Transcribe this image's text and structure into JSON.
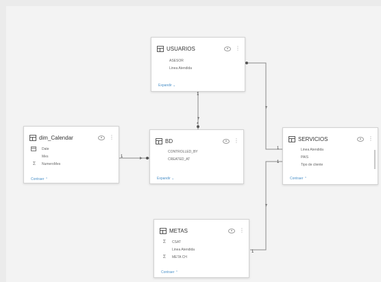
{
  "tables": {
    "usuarios": {
      "title": "USUARIOS",
      "fields": [
        "ASESOR",
        "Linea Atendida"
      ],
      "toggle": "Expandir"
    },
    "calendar": {
      "title": "dim_Calendar",
      "fields": [
        "Date",
        "Mes",
        "NumeroMes"
      ],
      "toggle": "Contraer"
    },
    "bd": {
      "title": "BD",
      "fields": [
        "CONTROLLED_BY",
        "CREATED_AT"
      ],
      "toggle": "Expandir"
    },
    "servicios": {
      "title": "SERVICIOS",
      "fields": [
        "Linea Atendida",
        "PAIS",
        "Tipo de cliente"
      ],
      "toggle": "Contraer"
    },
    "metas": {
      "title": "METAS",
      "fields": [
        "CSAT",
        "Linea Atendida",
        "META CH"
      ],
      "toggle": "Contraer"
    }
  },
  "cardinality": {
    "one": "1",
    "many": "*"
  },
  "icons": {
    "table": "table-icon",
    "visibility": "eye-icon",
    "more": "more-options-icon",
    "measure": "sigma-icon",
    "date": "calendar-icon"
  }
}
